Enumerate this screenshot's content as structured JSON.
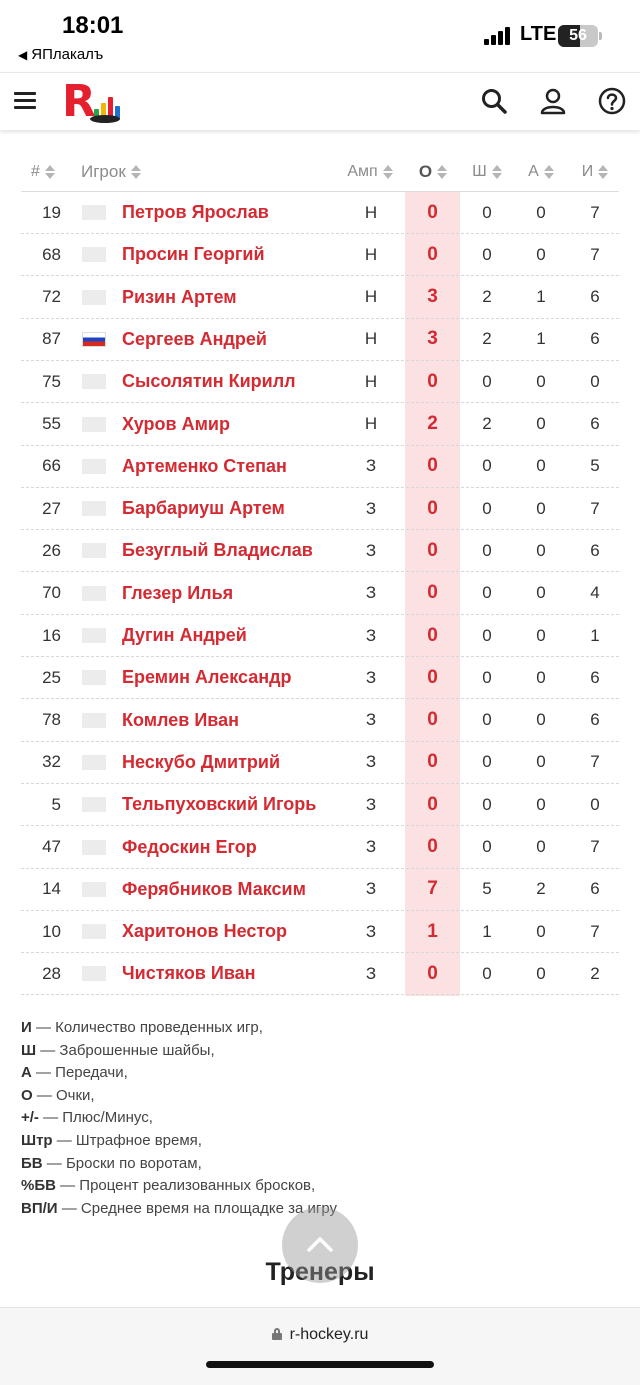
{
  "status_bar": {
    "time": "18:01",
    "back_app": "ЯПлакалъ",
    "network": "LTE",
    "battery": "56",
    "battery_level": 0.56
  },
  "header": {
    "menu_icon": "hamburger-icon",
    "logo_letter": "R",
    "icons": [
      "search-icon",
      "user-icon",
      "help-icon"
    ]
  },
  "table": {
    "headers": {
      "num": "#",
      "player": "Игрок",
      "pos": "Амп",
      "o": "О",
      "sh": "Ш",
      "a": "А",
      "i": "И"
    },
    "rows": [
      {
        "num": "19",
        "flag": "none",
        "name": "Петров Ярослав",
        "pos": "Н",
        "o": "0",
        "sh": "0",
        "a": "0",
        "i": "7"
      },
      {
        "num": "68",
        "flag": "none",
        "name": "Просин Георгий",
        "pos": "Н",
        "o": "0",
        "sh": "0",
        "a": "0",
        "i": "7"
      },
      {
        "num": "72",
        "flag": "none",
        "name": "Ризин Артем",
        "pos": "Н",
        "o": "3",
        "sh": "2",
        "a": "1",
        "i": "6"
      },
      {
        "num": "87",
        "flag": "ru",
        "name": "Сергеев Андрей",
        "pos": "Н",
        "o": "3",
        "sh": "2",
        "a": "1",
        "i": "6"
      },
      {
        "num": "75",
        "flag": "none",
        "name": "Сысолятин Кирилл",
        "pos": "Н",
        "o": "0",
        "sh": "0",
        "a": "0",
        "i": "0"
      },
      {
        "num": "55",
        "flag": "none",
        "name": "Хуров Амир",
        "pos": "Н",
        "o": "2",
        "sh": "2",
        "a": "0",
        "i": "6"
      },
      {
        "num": "66",
        "flag": "none",
        "name": "Артеменко Степан",
        "pos": "З",
        "o": "0",
        "sh": "0",
        "a": "0",
        "i": "5"
      },
      {
        "num": "27",
        "flag": "none",
        "name": "Барбариуш Артем",
        "pos": "З",
        "o": "0",
        "sh": "0",
        "a": "0",
        "i": "7"
      },
      {
        "num": "26",
        "flag": "none",
        "name": "Безуглый Владислав",
        "pos": "З",
        "o": "0",
        "sh": "0",
        "a": "0",
        "i": "6"
      },
      {
        "num": "70",
        "flag": "none",
        "name": "Глезер Илья",
        "pos": "З",
        "o": "0",
        "sh": "0",
        "a": "0",
        "i": "4"
      },
      {
        "num": "16",
        "flag": "none",
        "name": "Дугин Андрей",
        "pos": "З",
        "o": "0",
        "sh": "0",
        "a": "0",
        "i": "1"
      },
      {
        "num": "25",
        "flag": "none",
        "name": "Еремин Александр",
        "pos": "З",
        "o": "0",
        "sh": "0",
        "a": "0",
        "i": "6"
      },
      {
        "num": "78",
        "flag": "none",
        "name": "Комлев Иван",
        "pos": "З",
        "o": "0",
        "sh": "0",
        "a": "0",
        "i": "6"
      },
      {
        "num": "32",
        "flag": "none",
        "name": "Нескубо Дмитрий",
        "pos": "З",
        "o": "0",
        "sh": "0",
        "a": "0",
        "i": "7"
      },
      {
        "num": "5",
        "flag": "none",
        "name": "Тельпуховский Игорь",
        "pos": "З",
        "o": "0",
        "sh": "0",
        "a": "0",
        "i": "0"
      },
      {
        "num": "47",
        "flag": "none",
        "name": "Федоскин Егор",
        "pos": "З",
        "o": "0",
        "sh": "0",
        "a": "0",
        "i": "7"
      },
      {
        "num": "14",
        "flag": "none",
        "name": "Ферябников Максим",
        "pos": "З",
        "o": "7",
        "sh": "5",
        "a": "2",
        "i": "6"
      },
      {
        "num": "10",
        "flag": "none",
        "name": "Харитонов Нестор",
        "pos": "З",
        "o": "1",
        "sh": "1",
        "a": "0",
        "i": "7"
      },
      {
        "num": "28",
        "flag": "none",
        "name": "Чистяков Иван",
        "pos": "З",
        "o": "0",
        "sh": "0",
        "a": "0",
        "i": "2"
      }
    ]
  },
  "legend": [
    {
      "abbr": "И",
      "text": " — Количество проведенных игр,"
    },
    {
      "abbr": "Ш",
      "text": " — Заброшенные шайбы,"
    },
    {
      "abbr": "А",
      "text": " — Передачи,"
    },
    {
      "abbr": "О",
      "text": " — Очки,"
    },
    {
      "abbr": "+/-",
      "text": " — Плюс/Минус,"
    },
    {
      "abbr": "Штр",
      "text": " — Штрафное время,"
    },
    {
      "abbr": "БВ",
      "text": " — Броски по воротам,"
    },
    {
      "abbr": "%БВ",
      "text": " — Процент реализованных бросков,"
    },
    {
      "abbr": "ВП/И",
      "text": " — Среднее время на площадке за игру"
    }
  ],
  "coaches_title": "Тренеры",
  "scroll_top_icon": "chevron-up-icon",
  "browser": {
    "url": "r-hockey.ru"
  },
  "colors": {
    "accent": "#d42a32",
    "points_bg": "#fbe1e1"
  }
}
